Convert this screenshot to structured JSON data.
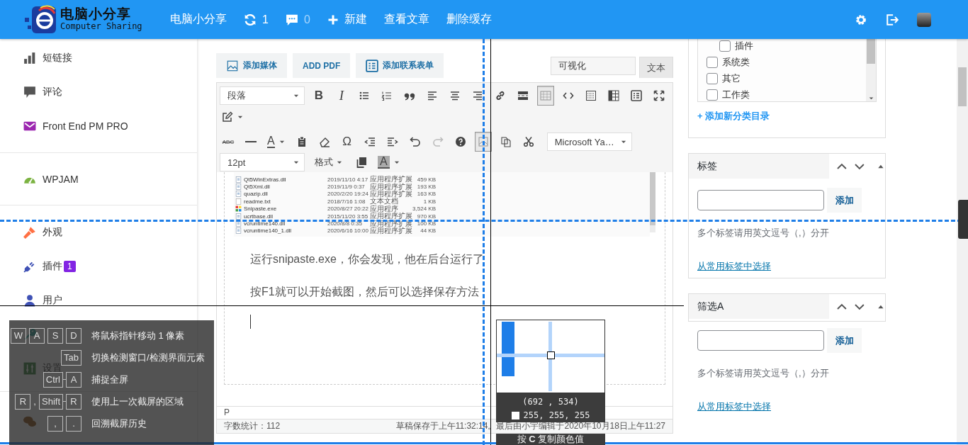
{
  "topbar": {
    "logo_title": "电脑小分享",
    "logo_subtitle": "Computer Sharing",
    "site_name": "电脑小分享",
    "updates": "1",
    "comments": "0",
    "new_label": "新建",
    "view_posts": "查看文章",
    "clear_cache": "删除缓存"
  },
  "sidebar": {
    "groups": [
      {
        "items": [
          {
            "kind": "entry",
            "label": "短链接"
          },
          {
            "kind": "entry",
            "label": "评论"
          },
          {
            "kind": "entry",
            "label": "Front End PM PRO"
          }
        ]
      },
      {
        "items": [
          {
            "kind": "entry",
            "label": "WPJAM"
          }
        ]
      },
      {
        "items": [
          {
            "kind": "entry",
            "label": "外观"
          },
          {
            "kind": "entry",
            "label": "插件",
            "badge": "1"
          },
          {
            "kind": "entry",
            "label": "用户"
          },
          {
            "kind": "covered"
          },
          {
            "kind": "entry",
            "label": "设置"
          }
        ]
      },
      {
        "items": [
          {
            "kind": "covered"
          }
        ]
      }
    ]
  },
  "editor": {
    "media_buttons": [
      "添加媒体",
      "ADD PDF",
      "添加联系表单"
    ],
    "tabs": [
      {
        "label": "可视化",
        "selected": true
      },
      {
        "label": "文本",
        "selected": false
      }
    ],
    "toolbar": [
      [
        {
          "kind": "select",
          "value": "段落"
        },
        {
          "kind": "glyph",
          "label": "B",
          "active": false,
          "disabled": false
        },
        {
          "kind": "glyph",
          "label": "I",
          "active": false,
          "disabled": false
        },
        {
          "kind": "icon",
          "active": false,
          "disabled": false
        },
        {
          "kind": "icon",
          "active": false,
          "disabled": false
        },
        {
          "kind": "icon",
          "active": false,
          "disabled": false
        },
        {
          "kind": "icon",
          "active": false,
          "disabled": false
        },
        {
          "kind": "icon",
          "active": false,
          "disabled": false
        },
        {
          "kind": "icon",
          "active": false,
          "disabled": false
        },
        {
          "kind": "icon",
          "active": false,
          "disabled": false
        },
        {
          "kind": "icon",
          "active": false,
          "disabled": false
        },
        {
          "kind": "icon",
          "active": true,
          "disabled": false
        },
        {
          "kind": "icon",
          "active": false,
          "disabled": false
        },
        {
          "kind": "icon",
          "active": false,
          "disabled": false
        },
        {
          "kind": "icon",
          "active": false,
          "disabled": false
        },
        {
          "kind": "icon",
          "active": false,
          "disabled": false
        },
        {
          "kind": "icon",
          "active": false,
          "disabled": false
        }
      ],
      [
        {
          "kind": "icon",
          "active": false,
          "disabled": false
        }
      ],
      [
        {
          "kind": "glyph",
          "label": "ABC",
          "active": false,
          "disabled": false
        },
        {
          "kind": "icon",
          "active": false,
          "disabled": false
        },
        {
          "kind": "glyph",
          "label": "A",
          "active": false,
          "disabled": false
        },
        {
          "kind": "icon",
          "active": false,
          "disabled": false
        },
        {
          "kind": "icon",
          "active": false,
          "disabled": false
        },
        {
          "kind": "glyph",
          "label": "Ω",
          "active": false,
          "disabled": false
        },
        {
          "kind": "icon",
          "active": false,
          "disabled": false
        },
        {
          "kind": "icon",
          "active": false,
          "disabled": false
        },
        {
          "kind": "icon",
          "active": false,
          "disabled": false
        },
        {
          "kind": "icon",
          "active": false,
          "disabled": true
        },
        {
          "kind": "icon",
          "active": false,
          "disabled": false
        },
        {
          "kind": "icon",
          "active": true,
          "disabled": false
        },
        {
          "kind": "icon",
          "active": false,
          "disabled": false
        },
        {
          "kind": "icon",
          "active": false,
          "disabled": false
        },
        {
          "kind": "select",
          "value": "Microsoft Ya…"
        }
      ],
      [
        {
          "kind": "select",
          "value": "12pt"
        },
        {
          "kind": "menu",
          "label": "格式"
        },
        {
          "kind": "icon",
          "active": false,
          "disabled": false
        },
        {
          "kind": "glyph",
          "label": "A",
          "active": false,
          "disabled": false
        }
      ]
    ],
    "files": [
      {
        "kind": "dll",
        "name": "Qt5WinExtras.dll",
        "date": "2019/11/10 4:17",
        "type": "应用程序扩展",
        "size": "459 KB"
      },
      {
        "kind": "dll",
        "name": "Qt5Xml.dll",
        "date": "2019/11/9 0:37",
        "type": "应用程序扩展",
        "size": "193 KB"
      },
      {
        "kind": "dll",
        "name": "quazip.dll",
        "date": "2020/2/20 19:24",
        "type": "应用程序扩展",
        "size": "163 KB"
      },
      {
        "kind": "txt",
        "name": "readme.txt",
        "date": "2018/7/16 1:08",
        "type": "文本文档",
        "size": "1 KB"
      },
      {
        "kind": "exe",
        "name": "Snipaste.exe",
        "date": "2020/8/27 20:22",
        "type": "应用程序",
        "size": "3,524 KB"
      },
      {
        "kind": "dll",
        "name": "ucrtbase.dll",
        "date": "2015/11/20 3:55",
        "type": "应用程序扩展",
        "size": "970 KB"
      },
      {
        "kind": "dll",
        "name": "vcruntime140.dll",
        "date": "2020/8/8 0:35",
        "type": "应用程序扩展",
        "size": "100 KB"
      },
      {
        "kind": "dll",
        "name": "vcruntime140_1.dll",
        "date": "2020/6/16 10:00",
        "type": "应用程序扩展",
        "size": "44 KB"
      }
    ],
    "paragraphs": [
      "运行snipaste.exe，你会发现，他在后台运行了",
      "按F1就可以开始截图，然后可以选择保存方法"
    ],
    "path": "P",
    "word_count": "字数统计：112",
    "save_status": "草稿保存于上午11:32:14。最后由小宇编辑于2020年10月18日上午11:27"
  },
  "categories": {
    "items": [
      {
        "children": [
          {
            "label": "插件",
            "checked": false
          }
        ]
      },
      {
        "label": "系统类",
        "checked": false
      },
      {
        "label": "其它",
        "checked": false
      },
      {
        "label": "工作类",
        "checked": false
      }
    ],
    "add_link": "+ 添加新分类目录"
  },
  "tag_boxes": [
    {
      "title": "标签",
      "button": "添加",
      "hint": "多个标签请用英文逗号（,）分开",
      "link": "从常用标签中选择"
    },
    {
      "title": "筛选A",
      "button": "添加",
      "hint": "多个标签请用英文逗号（,）分开",
      "link": "从常用标签中选择"
    }
  ],
  "snipaste": {
    "shortcuts": [
      {
        "combos": [
          [
            "W"
          ],
          [
            "A"
          ],
          [
            "S"
          ],
          [
            "D"
          ]
        ],
        "text": "将鼠标指针移动 1 像素"
      },
      {
        "combos": [
          [
            "Tab"
          ]
        ],
        "text": "切换检测窗口/检测界面元素"
      },
      {
        "combos": [
          [
            "Ctrl",
            "A"
          ]
        ],
        "text": "捕捉全屏"
      },
      {
        "combos": [
          [
            "R"
          ],
          [
            "Shift",
            "R"
          ]
        ],
        "separator": ",",
        "text": "使用上一次截屏的区域"
      },
      {
        "combos": [
          [
            ","
          ],
          [
            "."
          ]
        ],
        "text": "回溯截屏历史"
      }
    ],
    "magnifier": {
      "coords": "(692 , 534)",
      "rgb": "255, 255, 255",
      "hint": "按 **C** 复制颜色值"
    }
  }
}
